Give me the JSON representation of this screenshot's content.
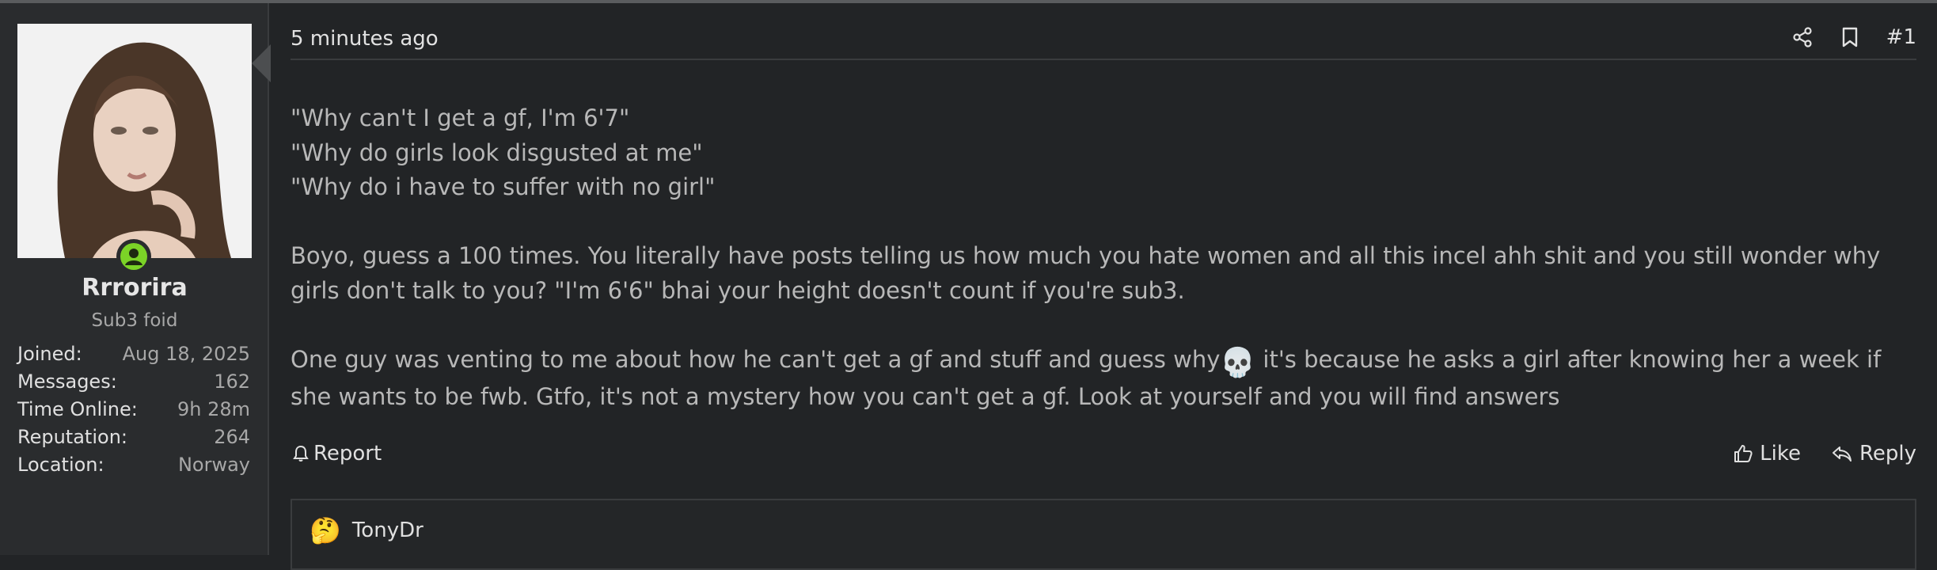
{
  "user": {
    "name": "Rrrorira",
    "title": "Sub3 foid",
    "stats": [
      {
        "label": "Joined:",
        "value": "Aug 18, 2025"
      },
      {
        "label": "Messages:",
        "value": "162"
      },
      {
        "label": "Time Online:",
        "value": "9h 28m"
      },
      {
        "label": "Reputation:",
        "value": "264"
      },
      {
        "label": "Location:",
        "value": "Norway"
      }
    ]
  },
  "post": {
    "time": "5 minutes ago",
    "number": "#1",
    "lines": [
      "\"Why can't I get a gf, I'm 6'7\"",
      "\"Why do girls look disgusted at me\"",
      "\"Why do i have to suffer with no girl\""
    ],
    "paragraph2": "Boyo, guess a 100 times. You literally have posts telling us how much you hate women and all this incel ahh shit and you still wonder why girls don't talk to you? \"I'm 6'6\" bhai your height doesn't count if you're sub3.",
    "paragraph3_before": "One guy was venting to me about how he can't get a gf and stuff and guess why",
    "paragraph3_emoji": "💀",
    "paragraph3_after": " it's because he asks a girl after knowing her a week if she wants to be fwb. Gtfo, it's not a mystery how you can't get a gf. Look at yourself and you will find answers"
  },
  "actions": {
    "report": "Report",
    "like": "Like",
    "reply": "Reply"
  },
  "quote": {
    "emoji": "🤔",
    "author": "TonyDr"
  },
  "colors": {
    "background": "#222426",
    "sidebar": "#2a2c2e",
    "online": "#7bd327"
  }
}
